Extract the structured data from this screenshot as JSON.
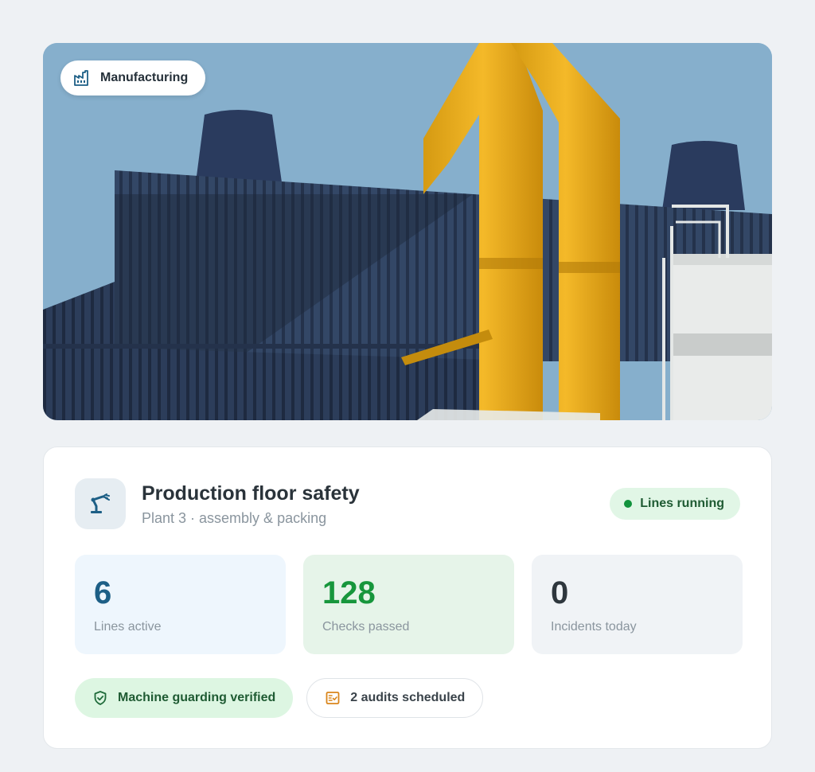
{
  "hero": {
    "category_label": "Manufacturing",
    "category_icon": "factory-icon"
  },
  "card": {
    "icon": "robotic-arm-icon",
    "title": "Production floor safety",
    "subtitle": "Plant 3 · assembly & packing",
    "status": {
      "label": "Lines running",
      "color": "#11933d"
    },
    "stats": [
      {
        "value": "6",
        "label": "Lines active",
        "color": "#1d5f86"
      },
      {
        "value": "128",
        "label": "Checks passed",
        "color": "#17963c"
      },
      {
        "value": "0",
        "label": "Incidents today",
        "color": "#2e363d"
      }
    ],
    "chips": [
      {
        "label": "Machine guarding verified",
        "icon": "shield-check-icon"
      },
      {
        "label": "2 audits scheduled",
        "icon": "checklist-icon"
      }
    ]
  }
}
